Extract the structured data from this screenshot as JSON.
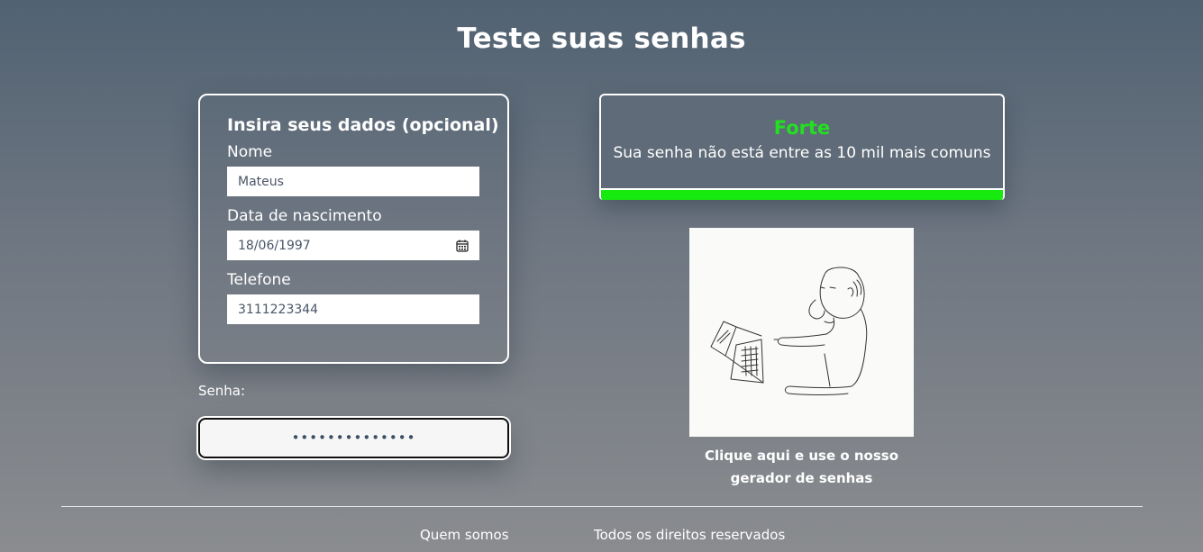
{
  "page": {
    "title": "Teste suas senhas"
  },
  "data_form": {
    "title": "Insira seus dados (opcional)",
    "fields": [
      {
        "label": "Nome",
        "value": "Mateus"
      },
      {
        "label": "Data de nascimento",
        "value": "18/06/1997",
        "icon": "calendar-icon"
      },
      {
        "label": "Telefone",
        "value": "3111223344"
      }
    ]
  },
  "password": {
    "label": "Senha:",
    "masked_value": "••••••••••••••"
  },
  "strength": {
    "level": "Forte",
    "message": "Sua senha não está entre as 10 mil mais comuns",
    "fill_fraction": 1.0,
    "level_color": "#22e020",
    "bar_color": "#16ea0e"
  },
  "generator": {
    "image_name": "cartoon-man-typing-password",
    "caption_line1": "Clique aqui e use o nosso",
    "caption_line2": "gerador de senhas"
  },
  "footer": {
    "about_link": "Quem somos",
    "rights": "Todos os direitos reservados"
  }
}
